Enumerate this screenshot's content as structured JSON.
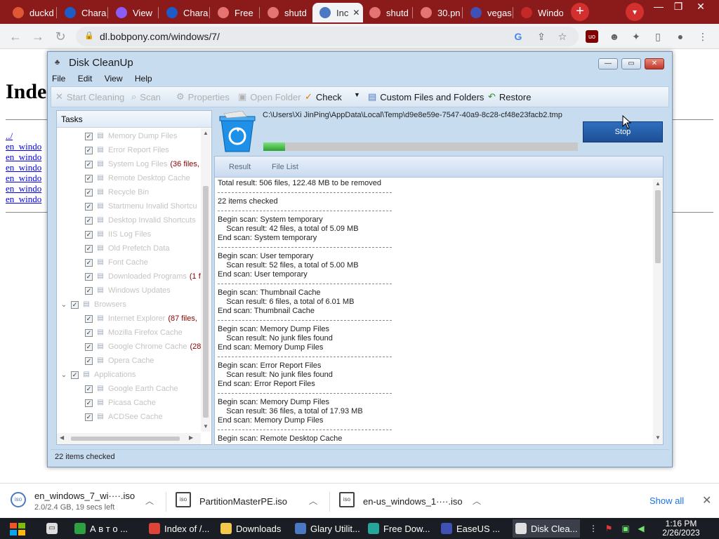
{
  "browser": {
    "tabs": [
      {
        "label": "duckd",
        "favColor": "#de5833",
        "active": false
      },
      {
        "label": "Chara",
        "favColor": "#1e5bc6",
        "active": false
      },
      {
        "label": "View",
        "favColor": "#8b5cf6",
        "active": false
      },
      {
        "label": "Chara",
        "favColor": "#1e5bc6",
        "active": false
      },
      {
        "label": "Free",
        "favColor": "#e57373",
        "active": false
      },
      {
        "label": "shutd",
        "favColor": "#e57373",
        "active": false
      },
      {
        "label": "Inc",
        "favColor": "#4a78c2",
        "active": true
      },
      {
        "label": "shutd",
        "favColor": "#e57373",
        "active": false
      },
      {
        "label": "30.pn",
        "favColor": "#e57373",
        "active": false
      },
      {
        "label": "vegas",
        "favColor": "#3f51b5",
        "active": false
      },
      {
        "label": "Windo",
        "favColor": "#c62828",
        "active": false
      }
    ],
    "new_tab": "+",
    "tab_search": "▾",
    "url": "dl.bobpony.com/windows/7/"
  },
  "page": {
    "title": "Inde",
    "links": [
      "../",
      "en_windo",
      "en_windo",
      "en_windo",
      "en_windo",
      "en_windo",
      "en_windo"
    ]
  },
  "diskcleanup": {
    "title": "Disk CleanUp",
    "menu": [
      "File",
      "Edit",
      "View",
      "Help"
    ],
    "toolbar": {
      "start_cleaning": "Start Cleaning",
      "scan": "Scan",
      "properties": "Properties",
      "open_folder": "Open Folder",
      "check": "Check",
      "custom_files": "Custom Files and Folders",
      "restore": "Restore"
    },
    "tasks_header": "Tasks",
    "tasks": [
      {
        "label": "Memory Dump Files",
        "count": "",
        "level": 2,
        "type": "item"
      },
      {
        "label": "Error Report Files",
        "count": "",
        "level": 2,
        "type": "item"
      },
      {
        "label": "System Log Files",
        "count": "(36 files,",
        "level": 2,
        "type": "item"
      },
      {
        "label": "Remote Desktop Cache",
        "count": "",
        "level": 2,
        "type": "item"
      },
      {
        "label": "Recycle Bin",
        "count": "",
        "level": 2,
        "type": "item"
      },
      {
        "label": "Startmenu Invalid Shortcu",
        "count": "",
        "level": 2,
        "type": "item"
      },
      {
        "label": "Desktop Invalid Shortcuts",
        "count": "",
        "level": 2,
        "type": "item"
      },
      {
        "label": "IIS Log Files",
        "count": "",
        "level": 2,
        "type": "item"
      },
      {
        "label": "Old Prefetch Data",
        "count": "",
        "level": 2,
        "type": "item"
      },
      {
        "label": "Font Cache",
        "count": "",
        "level": 2,
        "type": "item"
      },
      {
        "label": "Downloaded Programs",
        "count": "(1 f",
        "level": 2,
        "type": "item"
      },
      {
        "label": "Windows Updates",
        "count": "",
        "level": 2,
        "type": "item"
      },
      {
        "label": "Browsers",
        "count": "",
        "level": 1,
        "type": "group"
      },
      {
        "label": "Internet Explorer",
        "count": "(87 files,",
        "level": 2,
        "type": "item"
      },
      {
        "label": "Mozilla Firefox Cache",
        "count": "",
        "level": 2,
        "type": "item"
      },
      {
        "label": "Google Chrome Cache",
        "count": "(28",
        "level": 2,
        "type": "item"
      },
      {
        "label": "Opera Cache",
        "count": "",
        "level": 2,
        "type": "item"
      },
      {
        "label": "Applications",
        "count": "",
        "level": 1,
        "type": "group"
      },
      {
        "label": "Google Earth Cache",
        "count": "",
        "level": 2,
        "type": "item"
      },
      {
        "label": "Picasa Cache",
        "count": "",
        "level": 2,
        "type": "item"
      },
      {
        "label": "ACDSee Cache",
        "count": "",
        "level": 2,
        "type": "item"
      }
    ],
    "current_path": "C:\\Users\\Xi JinPing\\AppData\\Local\\Temp\\d9e8e59e-7547-40a9-8c28-cf48e23facb2.tmp",
    "progress": 0.07,
    "stop_label": "Stop",
    "result_tabs": [
      "Result",
      "File List"
    ],
    "log": [
      {
        "t": "line",
        "text": "Total result: 506 files, 122.48 MB to be removed"
      },
      {
        "t": "sep"
      },
      {
        "t": "line",
        "text": "22 items checked"
      },
      {
        "t": "sep"
      },
      {
        "t": "line",
        "text": "Begin scan: System temporary"
      },
      {
        "t": "line",
        "text": "    Scan result: 42 files, a total of 5.09 MB"
      },
      {
        "t": "line",
        "text": "End scan: System temporary"
      },
      {
        "t": "sep"
      },
      {
        "t": "line",
        "text": "Begin scan: User temporary"
      },
      {
        "t": "line",
        "text": "    Scan result: 52 files, a total of 5.00 MB"
      },
      {
        "t": "line",
        "text": "End scan: User temporary"
      },
      {
        "t": "sep"
      },
      {
        "t": "line",
        "text": "Begin scan: Thumbnail Cache"
      },
      {
        "t": "line",
        "text": "    Scan result: 6 files, a total of 6.01 MB"
      },
      {
        "t": "line",
        "text": "End scan: Thumbnail Cache"
      },
      {
        "t": "sep"
      },
      {
        "t": "line",
        "text": "Begin scan: Memory Dump Files"
      },
      {
        "t": "line",
        "text": "    Scan result: No junk files found"
      },
      {
        "t": "line",
        "text": "End scan: Memory Dump Files"
      },
      {
        "t": "sep"
      },
      {
        "t": "line",
        "text": "Begin scan: Error Report Files"
      },
      {
        "t": "line",
        "text": "    Scan result: No junk files found"
      },
      {
        "t": "line",
        "text": "End scan: Error Report Files"
      },
      {
        "t": "sep"
      },
      {
        "t": "line",
        "text": "Begin scan: Memory Dump Files"
      },
      {
        "t": "line",
        "text": "    Scan result: 36 files, a total of 17.93 MB"
      },
      {
        "t": "line",
        "text": "End scan: Memory Dump Files"
      },
      {
        "t": "sep"
      },
      {
        "t": "line",
        "text": "Begin scan: Remote Desktop Cache"
      }
    ],
    "status": "22 items checked"
  },
  "downloads": [
    {
      "name": "en_windows_7_wi····.iso",
      "sub": "2.0/2.4 GB, 19 secs left"
    },
    {
      "name": "PartitionMasterPE.iso",
      "sub": ""
    },
    {
      "name": "en-us_windows_1····.iso",
      "sub": ""
    }
  ],
  "downloads_show_all": "Show all",
  "taskbar": {
    "items": [
      {
        "label": "А в т о ...",
        "color": "#2ea043"
      },
      {
        "label": "Index of /...",
        "color": "#db4437"
      },
      {
        "label": "Downloads",
        "color": "#f2c94c"
      },
      {
        "label": "Glary Utilit...",
        "color": "#4a78c2"
      },
      {
        "label": "Free Dow...",
        "color": "#26a69a"
      },
      {
        "label": "EaseUS ...",
        "color": "#3f51b5"
      },
      {
        "label": "Disk Clea...",
        "color": "#e0e0e0"
      }
    ],
    "time": "1:16 PM",
    "date": "2/26/2023"
  }
}
